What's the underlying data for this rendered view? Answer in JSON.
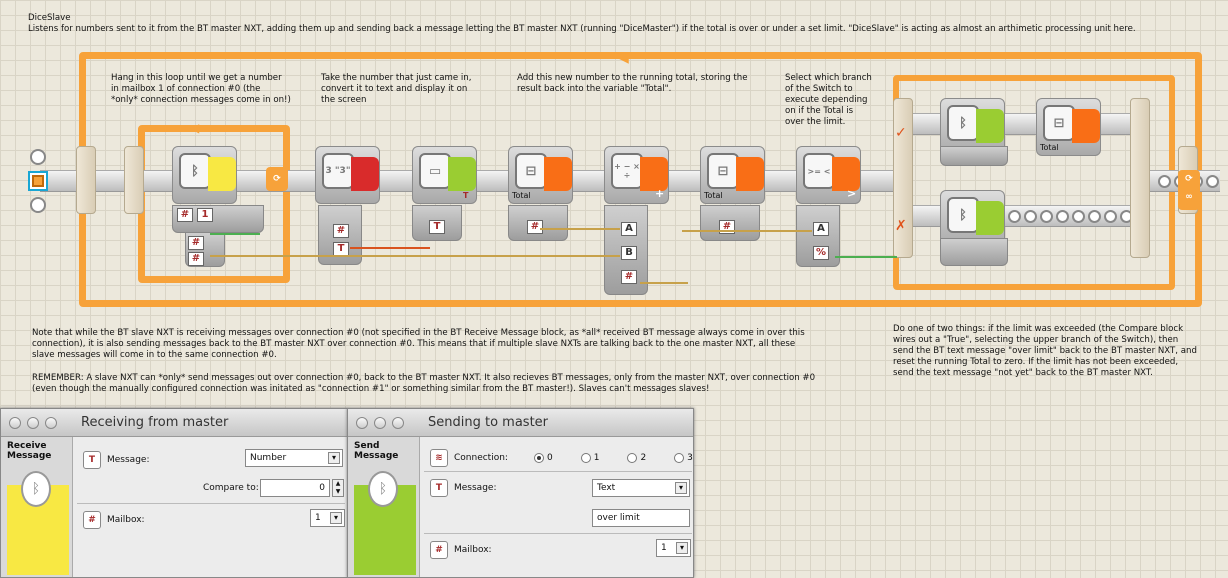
{
  "header": {
    "title": "DiceSlave",
    "description": "Listens for numbers sent to it from the BT master NXT, adding them up and sending back a message letting the BT master NXT (running \"DiceMaster\") if the total is over or under a set limit. \"DiceSlave\" is acting as almost an arthimetic processing unit here."
  },
  "comments": {
    "loop_wait": "Hang in this loop until we get a number\nin mailbox 1 of  connection #0 (the\n*only* connection messages come in on!)",
    "convert": "Take the number that just came in,\nconvert it to text and display it on\nthe screen",
    "add": "Add this new number to the running total, storing the\nresult  back into the variable \"Total\".",
    "switch": "Select which branch\nof the Switch to\nexecute depending\non if the Total is\nover the limit.",
    "note1": "Note that while the BT slave NXT is receiving messages over connection #0 (not specified in the BT Receive Message block, as *all* received BT message always come in over this\nconnection), it is also sending messages back to the BT master NXT over connection #0. This means that if multiple slave NXTs are talking back to the one master NXT, all these\nslave messages will come in to the same connection #0.",
    "note2": "REMEMBER: A slave NXT can *only* send messages out over connection #0, back to the BT master NXT. It also recieves BT messages, only from the master NXT, over connection #0\n(even though the manually configured connection was initated as \"connection #1\" or something similar from the BT master!). Slaves can't messages slaves!",
    "right_note": "Do one of two things: if the limit was exceeded (the Compare block\nwires out a \"True\", selecting the upper branch of the Switch), then\nsend the BT text message \"over limit\" back to the BT master NXT, and\nreset the running Total to zero. If the limit has not been exceeded,\nsend the text message \"not yet\" back to the BT master NXT."
  },
  "blocks": {
    "variable_read_label": "Total",
    "variable_write_label": "Total",
    "switch_variable_label": "Total",
    "number_to_text_icon": "3 \"3\"",
    "compare_icon": ">= <",
    "math_icon": "+ − × ÷",
    "plug_a": "A",
    "plug_b": "B",
    "compare_symbol": ">",
    "math_symbol": "+"
  },
  "receive_window": {
    "title": "Receiving from master",
    "block_name": "Receive Message",
    "message_label": "Message:",
    "message_value": "Number",
    "compare_label": "Compare to:",
    "compare_value": "0",
    "mailbox_label": "Mailbox:",
    "mailbox_value": "1",
    "accent": "#f8e843"
  },
  "send_window": {
    "title": "Sending to master",
    "block_name": "Send Message",
    "connection_label": "Connection:",
    "connections": [
      "0",
      "1",
      "2",
      "3"
    ],
    "selected_connection": "0",
    "message_label": "Message:",
    "message_type": "Text",
    "message_value": "over limit",
    "mailbox_label": "Mailbox:",
    "mailbox_value": "1",
    "accent": "#9acd32"
  },
  "icons": {
    "bluetooth": "bluetooth-icon",
    "loop": "loop-icon",
    "switch_true": "check-icon",
    "switch_false": "cross-icon"
  },
  "colors": {
    "loop_orange": "#f7a23a",
    "receive_yellow": "#f8e843",
    "data_red": "#d92b2b",
    "display_green": "#9acd32",
    "variable_orange": "#f96e16"
  }
}
